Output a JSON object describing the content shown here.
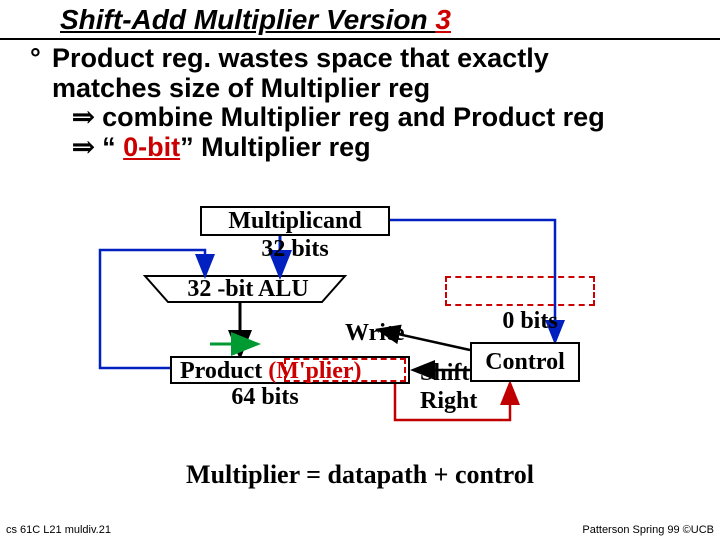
{
  "title": {
    "pre": "Shift-Add Multiplier Version ",
    "ver": "3"
  },
  "bullet": {
    "line1a": "Product reg. wastes space that exactly",
    "line1b": "matches size of Multiplier reg",
    "line2": " combine Multiplier reg and Product reg",
    "line3a": " “ ",
    "line3b": "0-bit",
    "line3c": "” Multiplier reg"
  },
  "diagram": {
    "multiplicand": "Multiplicand",
    "multiplicand_bits": "32 bits",
    "alu": "32 -bit ALU",
    "product": "Product",
    "mplier": "(M'plier)",
    "product_bits": "64 bits",
    "write": "Write",
    "shift_right_a": "Shift",
    "shift_right_b": "Right",
    "control": "Control",
    "zero_bits": "0 bits"
  },
  "caption": "Multiplier = datapath + control",
  "footer_left": "cs 61C  L21  muldiv.21",
  "footer_right": "Patterson Spring 99  ©UCB"
}
